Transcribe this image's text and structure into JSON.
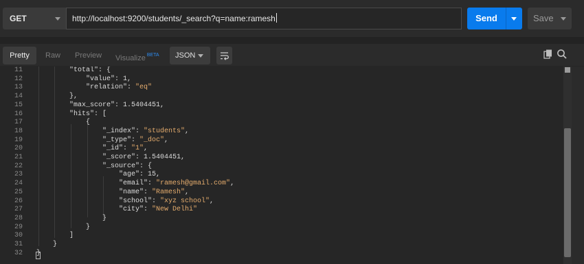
{
  "request": {
    "method": "GET",
    "url": "http://localhost:9200/students/_search?q=name:ramesh",
    "send_label": "Send",
    "save_label": "Save"
  },
  "response_toolbar": {
    "tabs": [
      {
        "label": "Pretty",
        "active": true
      },
      {
        "label": "Raw",
        "active": false
      },
      {
        "label": "Preview",
        "active": false
      },
      {
        "label": "Visualize",
        "active": false,
        "badge": "BETA"
      }
    ],
    "format": "JSON",
    "icons": [
      "wrap-lines-icon",
      "copy-icon",
      "search-icon"
    ]
  },
  "code_lines": [
    {
      "n": "11",
      "t": "        \"total\": {"
    },
    {
      "n": "12",
      "t": "            \"value\": 1,"
    },
    {
      "n": "13",
      "t": "            \"relation\": \"eq\""
    },
    {
      "n": "14",
      "t": "        },"
    },
    {
      "n": "15",
      "t": "        \"max_score\": 1.5404451,"
    },
    {
      "n": "16",
      "t": "        \"hits\": ["
    },
    {
      "n": "17",
      "t": "            {"
    },
    {
      "n": "18",
      "t": "                \"_index\": \"students\","
    },
    {
      "n": "19",
      "t": "                \"_type\": \"_doc\","
    },
    {
      "n": "20",
      "t": "                \"_id\": \"1\","
    },
    {
      "n": "21",
      "t": "                \"_score\": 1.5404451,"
    },
    {
      "n": "22",
      "t": "                \"_source\": {"
    },
    {
      "n": "23",
      "t": "                    \"age\": 15,"
    },
    {
      "n": "24",
      "t": "                    \"email\": \"ramesh@gmail.com\","
    },
    {
      "n": "25",
      "t": "                    \"name\": \"Ramesh\","
    },
    {
      "n": "26",
      "t": "                    \"school\": \"xyz school\","
    },
    {
      "n": "27",
      "t": "                    \"city\": \"New Delhi\""
    },
    {
      "n": "28",
      "t": "                }"
    },
    {
      "n": "29",
      "t": "            }"
    },
    {
      "n": "30",
      "t": "        ]"
    },
    {
      "n": "31",
      "t": "    }"
    },
    {
      "n": "32",
      "t": "}"
    }
  ],
  "colors": {
    "accent": "#097bed",
    "string": "#e5ac6d",
    "background": "#262626"
  }
}
